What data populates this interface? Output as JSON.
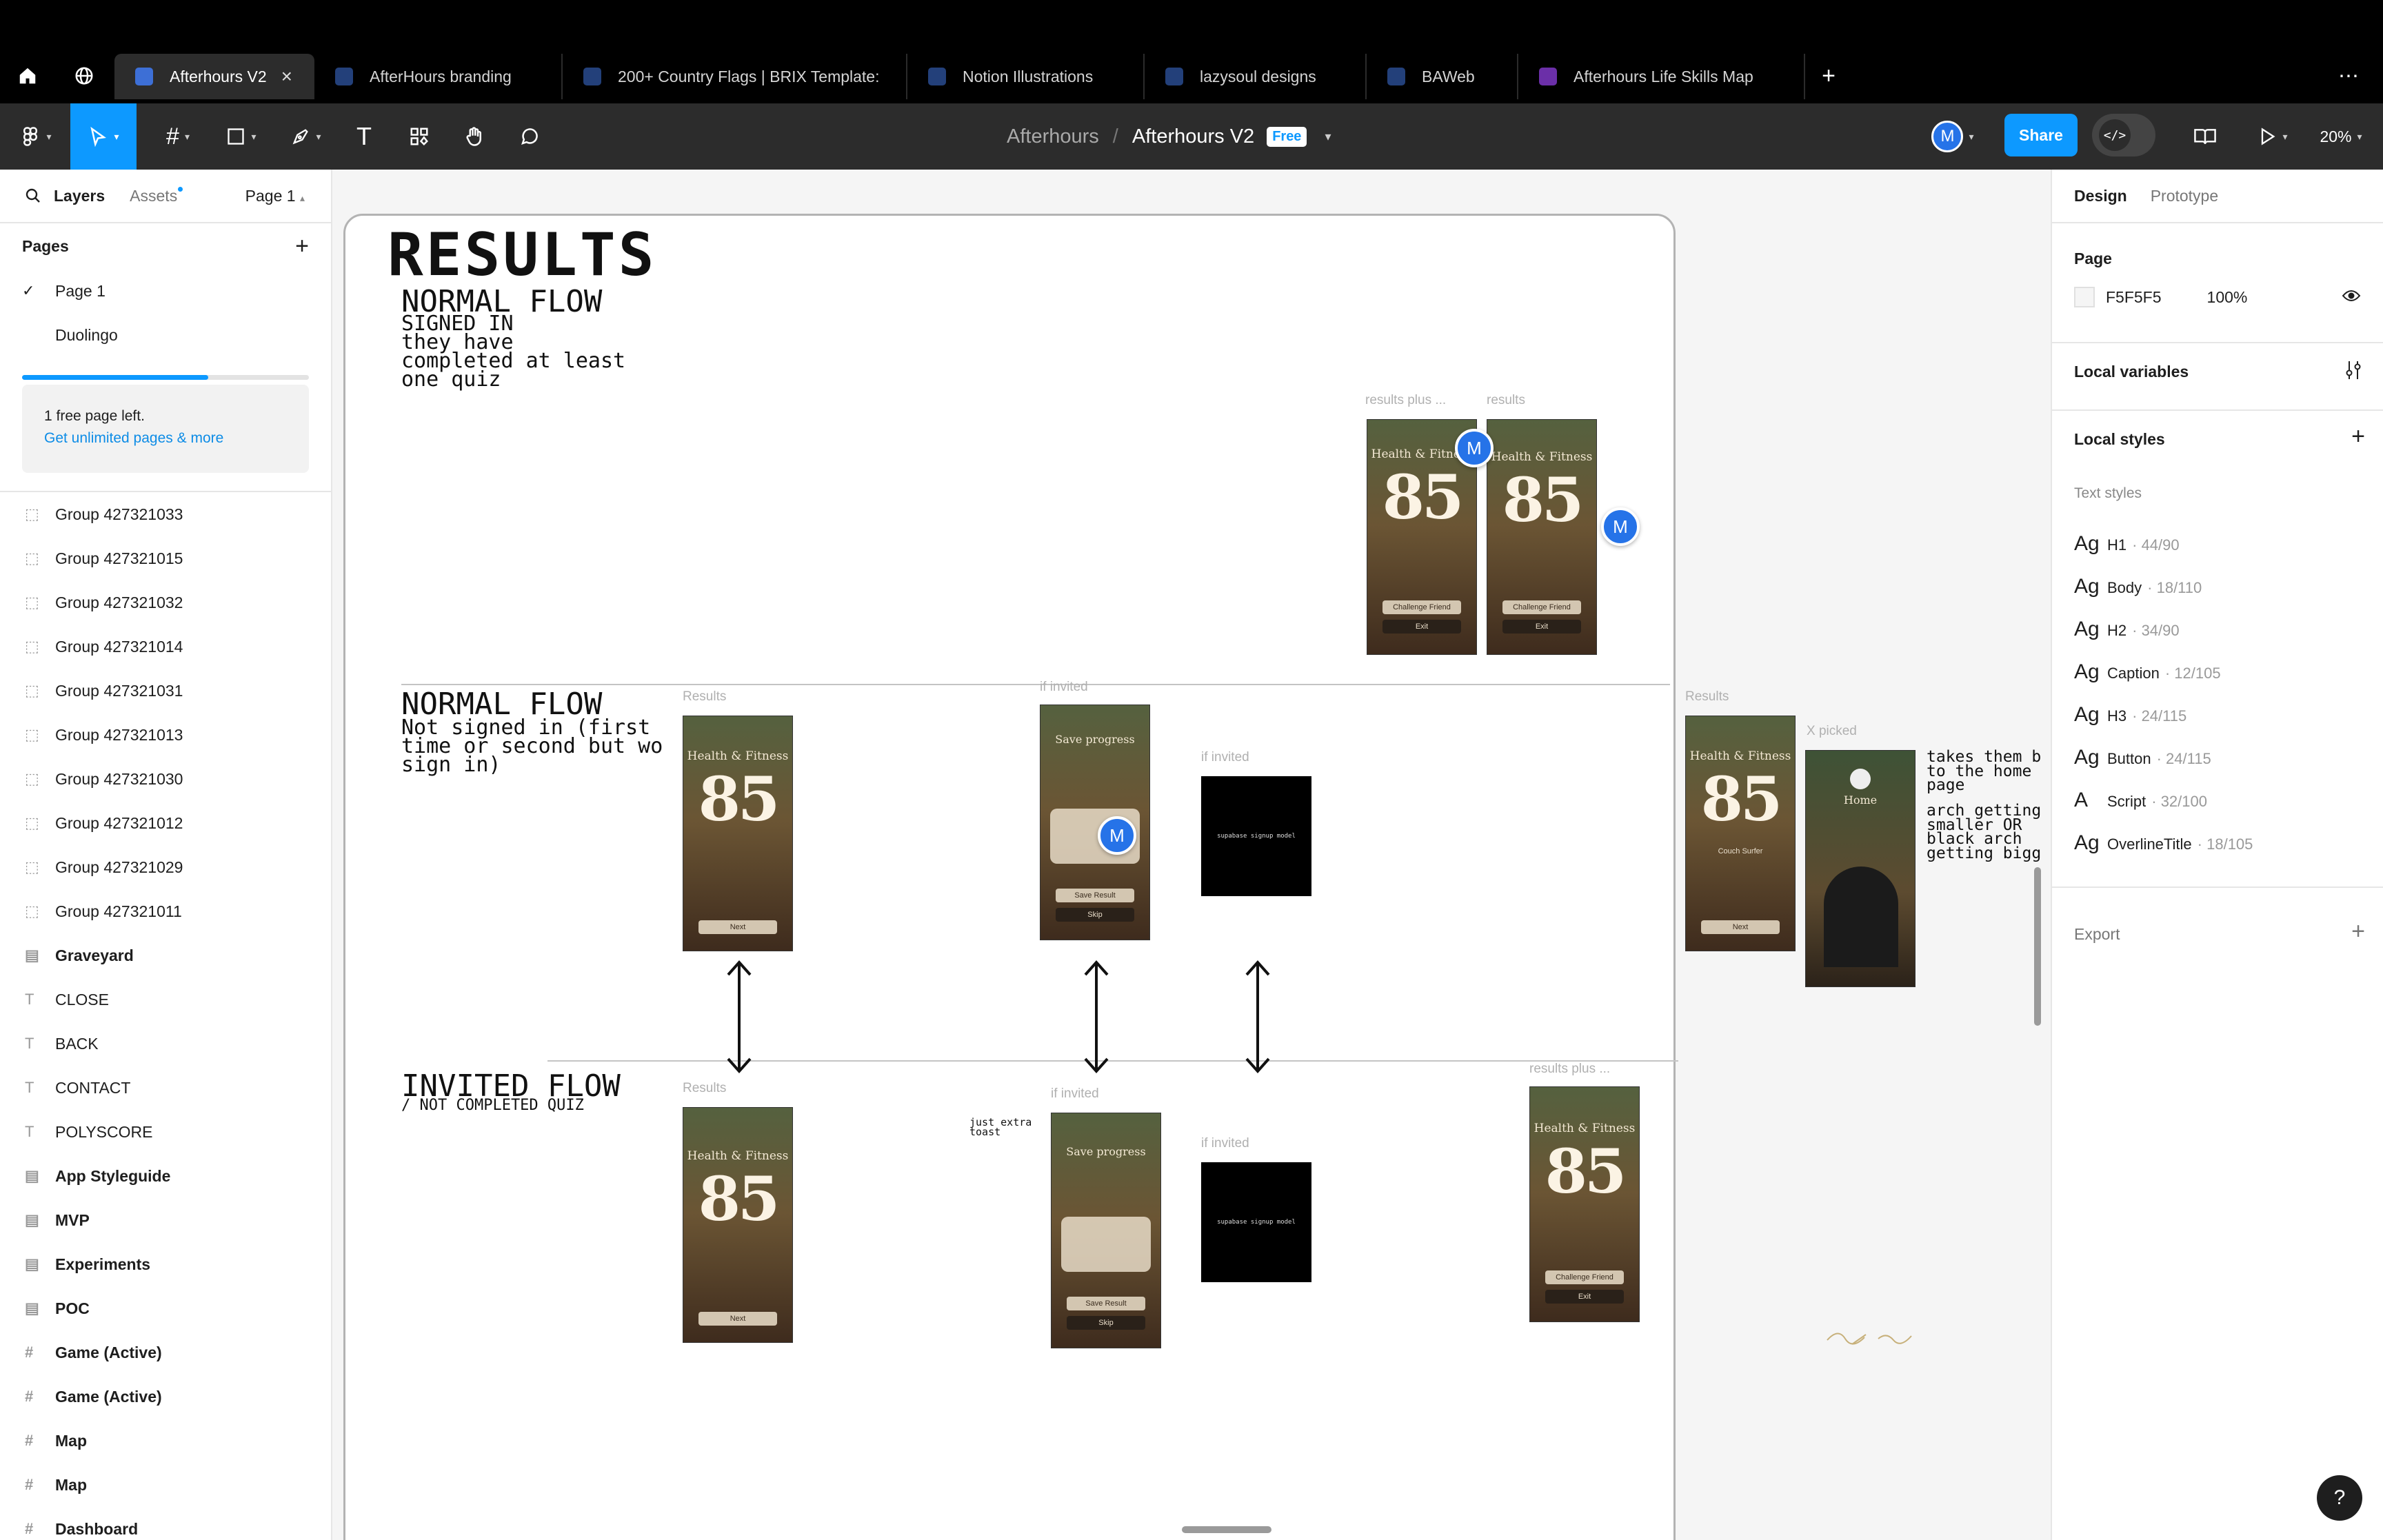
{
  "tabs": [
    {
      "label": "Afterhours V2",
      "active": true
    },
    {
      "label": "AfterHours branding"
    },
    {
      "label": "200+ Country Flags | BRIX Template:"
    },
    {
      "label": "Notion Illustrations"
    },
    {
      "label": "lazysoul designs"
    },
    {
      "label": "BAWeb"
    },
    {
      "label": "Afterhours Life Skills Map"
    }
  ],
  "toolbar": {
    "project": "Afterhours",
    "file": "Afterhours V2",
    "plan_badge": "Free",
    "avatar": "M",
    "share_label": "Share",
    "zoom": "20%"
  },
  "left_panel": {
    "tab_layers": "Layers",
    "tab_assets": "Assets",
    "page_selector": "Page 1",
    "pages_title": "Pages",
    "pages": [
      {
        "label": "Page 1",
        "current": true
      },
      {
        "label": "Duolingo"
      }
    ],
    "promo_line1": "1 free page left.",
    "promo_link": "Get unlimited pages & more",
    "promo_progress": 0.65,
    "layers": [
      {
        "label": "Group 427321033",
        "icon": "group-icon"
      },
      {
        "label": "Group 427321015",
        "icon": "group-icon"
      },
      {
        "label": "Group 427321032",
        "icon": "group-icon"
      },
      {
        "label": "Group 427321014",
        "icon": "group-icon"
      },
      {
        "label": "Group 427321031",
        "icon": "group-icon"
      },
      {
        "label": "Group 427321013",
        "icon": "group-icon"
      },
      {
        "label": "Group 427321030",
        "icon": "group-icon"
      },
      {
        "label": "Group 427321012",
        "icon": "group-icon"
      },
      {
        "label": "Group 427321029",
        "icon": "group-icon"
      },
      {
        "label": "Group 427321011",
        "icon": "group-icon"
      },
      {
        "label": "Graveyard",
        "icon": "section-icon",
        "bold": true
      },
      {
        "label": "CLOSE",
        "icon": "text-icon"
      },
      {
        "label": "BACK",
        "icon": "text-icon"
      },
      {
        "label": "CONTACT",
        "icon": "text-icon"
      },
      {
        "label": "POLYSCORE",
        "icon": "text-icon"
      },
      {
        "label": "App Styleguide",
        "icon": "section-icon",
        "bold": true
      },
      {
        "label": "MVP",
        "icon": "section-icon",
        "bold": true
      },
      {
        "label": "Experiments",
        "icon": "section-icon",
        "bold": true
      },
      {
        "label": "POC",
        "icon": "section-icon",
        "bold": true
      },
      {
        "label": "Game (Active)",
        "icon": "frame-icon",
        "bold": true
      },
      {
        "label": "Game (Active)",
        "icon": "frame-icon",
        "bold": true
      },
      {
        "label": "Map",
        "icon": "frame-icon",
        "bold": true
      },
      {
        "label": "Map",
        "icon": "frame-icon",
        "bold": true
      },
      {
        "label": "Dashboard",
        "icon": "frame-icon",
        "bold": true
      }
    ]
  },
  "right_panel": {
    "tab_design": "Design",
    "tab_prototype": "Prototype",
    "page_title": "Page",
    "bg_color": "F5F5F5",
    "bg_opacity": "100%",
    "local_variables": "Local variables",
    "local_styles": "Local styles",
    "text_styles_title": "Text styles",
    "text_styles": [
      {
        "ag": "Ag",
        "name": "H1",
        "size": "· 44/90"
      },
      {
        "ag": "Ag",
        "name": "Body",
        "size": "· 18/110"
      },
      {
        "ag": "Ag",
        "name": "H2",
        "size": "· 34/90"
      },
      {
        "ag": "Ag",
        "name": "Caption",
        "size": "· 12/105"
      },
      {
        "ag": "Ag",
        "name": "H3",
        "size": "· 24/115"
      },
      {
        "ag": "Ag",
        "name": "Button",
        "size": "· 24/115"
      },
      {
        "ag": "A",
        "name": "Script",
        "size": "· 32/100"
      },
      {
        "ag": "Ag",
        "name": "OverlineTitle",
        "size": "· 18/105"
      }
    ],
    "export": "Export"
  },
  "canvas": {
    "title": "RESULTS",
    "flow1_title": "NORMAL FLOW",
    "flow1_note": "SIGNED IN\nthey have\ncompleted at least\none quiz",
    "flow2_title": "NORMAL FLOW",
    "flow2_note": "Not signed in (first\ntime or second but wo\nsign in)",
    "flow3_title": "INVITED FLOW",
    "flow3_note": "/ NOT COMPLETED QUIZ",
    "label_results_plus": "results plus ...",
    "label_results": "results",
    "label_Results": "Results",
    "label_if_invited": "if invited",
    "label_x_picked": "X picked",
    "label_results_plus2": "results plus ...",
    "note_home": "takes them b\nto the home\npage",
    "note_arch": "arch getting\nsmaller OR\nblack arch\ngetting bigg",
    "note_toast": "just extra\ntoast",
    "phone_title": "Health & Fitness",
    "phone_score": "85",
    "save_title": "Save progress",
    "btn_challenge": "Challenge Friend",
    "btn_exit": "Exit",
    "btn_next": "Next",
    "btn_save": "Save Result",
    "btn_skip": "Skip",
    "couch_surfer": "Couch Surfer",
    "home": "Home",
    "modal_text": "supabase signup model",
    "cursor_avatar": "M"
  },
  "colors": {
    "accent": "#0d99ff",
    "avatar": "#2673e8",
    "canvas_bg": "#f5f5f5"
  }
}
